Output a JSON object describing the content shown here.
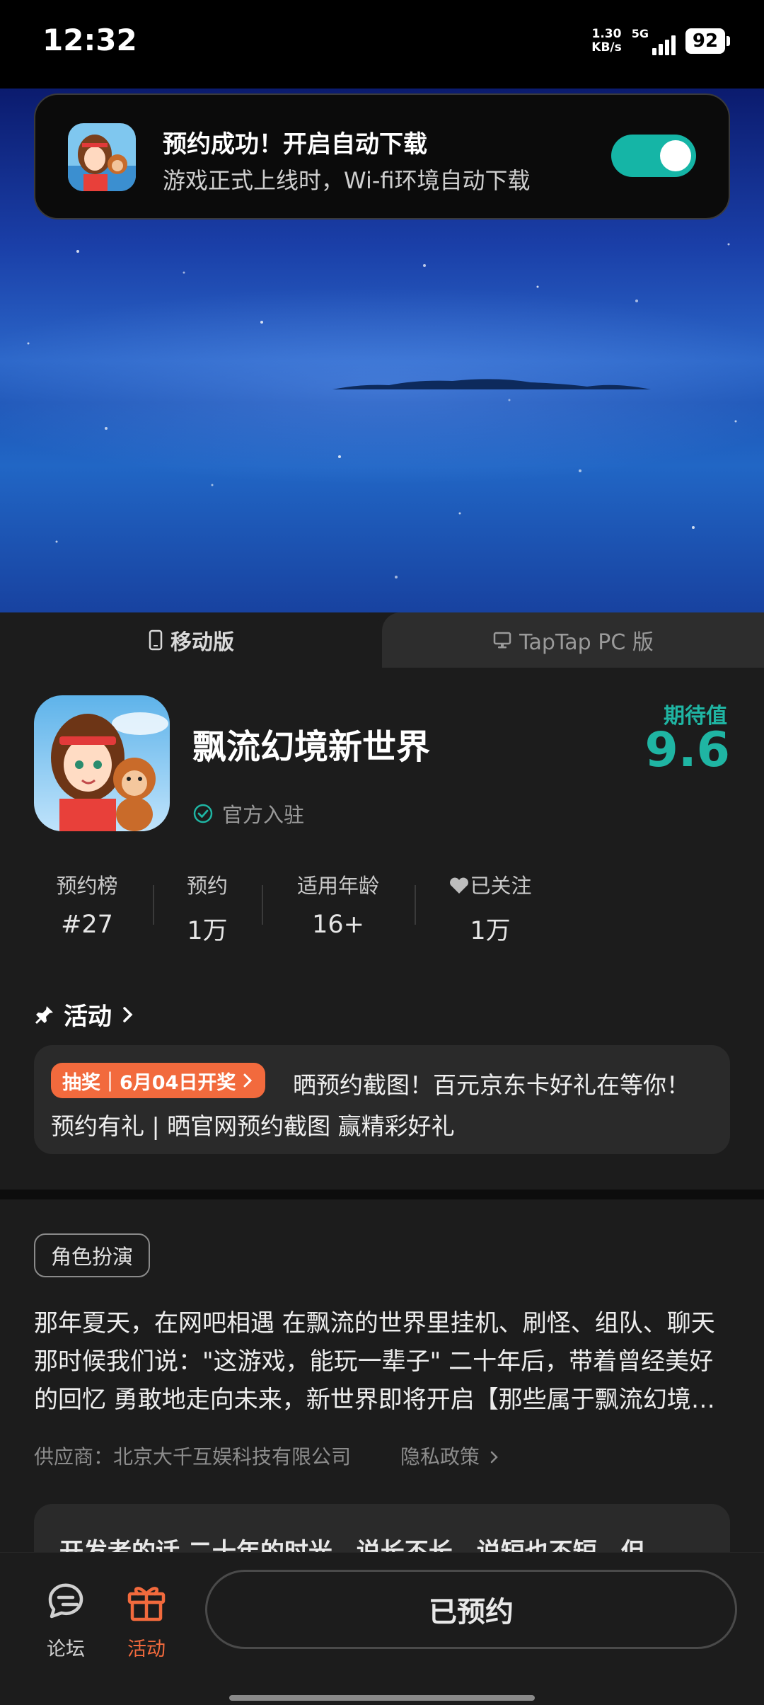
{
  "status_bar": {
    "time": "12:32",
    "net_speed_value": "1.30",
    "net_speed_unit": "KB/s",
    "network": "5G",
    "battery": "92"
  },
  "notification": {
    "title": "预约成功！开启自动下载",
    "subtitle": "游戏正式上线时，Wi-fi环境自动下载",
    "toggle_on": true,
    "accent_color": "#15b5a6"
  },
  "platform_tabs": {
    "mobile": "移动版",
    "pc": "TapTap PC 版",
    "active": "mobile"
  },
  "game": {
    "title": "飘流幻境新世界",
    "official_badge": "官方入驻",
    "expectation_label": "期待值",
    "expectation_score": "9.6"
  },
  "stats": [
    {
      "label": "预约榜",
      "value": "#27"
    },
    {
      "label": "预约",
      "value": "1万"
    },
    {
      "label": "适用年龄",
      "value": "16+"
    },
    {
      "label": "已关注",
      "value": "1万"
    }
  ],
  "activity": {
    "heading": "活动",
    "badge": "抽奖｜6月04日开奖",
    "line1": "晒预约截图！百元京东卡好礼在等你！",
    "line2": "预约有礼 | 晒官网预约截图 赢精彩好礼"
  },
  "genre_tag": "角色扮演",
  "description": "那年夏天，在网吧相遇 在飘流的世界里挂机、刷怪、组队、聊天 那时候我们说：\"这游戏，能玩一辈子\" 二十年后，带着曾经美好的回忆 勇敢地走向未来，新世界即将开启【那些属于飘流幻境的回忆】",
  "supplier": "供应商：北京大千互娱科技有限公司",
  "privacy": "隐私政策",
  "developer_note": "开发者的话  二十年的时光，说长不长，说短也不短，但",
  "bottom_nav": {
    "forum": "论坛",
    "activity": "活动",
    "reserved_button": "已预约",
    "active_color": "#f26a3d"
  }
}
